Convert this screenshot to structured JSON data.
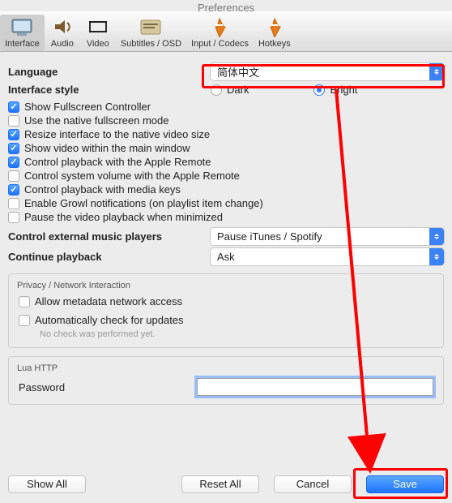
{
  "title": "Preferences",
  "toolbar": {
    "tabs": [
      {
        "label": "Interface",
        "active": true
      },
      {
        "label": "Audio"
      },
      {
        "label": "Video"
      },
      {
        "label": "Subtitles / OSD"
      },
      {
        "label": "Input / Codecs"
      },
      {
        "label": "Hotkeys"
      }
    ]
  },
  "language": {
    "label": "Language",
    "value": "简体中文"
  },
  "interface_style": {
    "label": "Interface style",
    "options": {
      "dark": "Dark",
      "bright": "Bright"
    },
    "selected": "bright"
  },
  "checks": [
    {
      "label": "Show Fullscreen Controller",
      "checked": true
    },
    {
      "label": "Use the native fullscreen mode",
      "checked": false
    },
    {
      "label": "Resize interface to the native video size",
      "checked": true
    },
    {
      "label": "Show video within the main window",
      "checked": true
    },
    {
      "label": "Control playback with the Apple Remote",
      "checked": true
    },
    {
      "label": "Control system volume with the Apple Remote",
      "checked": false
    },
    {
      "label": "Control playback with media keys",
      "checked": true
    },
    {
      "label": "Enable Growl notifications (on playlist item change)",
      "checked": false
    },
    {
      "label": "Pause the video playback when minimized",
      "checked": false
    }
  ],
  "external_players": {
    "label": "Control external music players",
    "value": "Pause iTunes / Spotify"
  },
  "continue_playback": {
    "label": "Continue playback",
    "value": "Ask"
  },
  "privacy": {
    "title": "Privacy / Network Interaction",
    "allow_metadata": {
      "label": "Allow metadata network access",
      "checked": false
    },
    "auto_update": {
      "label": "Automatically check for updates",
      "checked": false
    },
    "no_check": "No check was performed yet."
  },
  "lua": {
    "title": "Lua HTTP",
    "password_label": "Password",
    "password_value": ""
  },
  "buttons": {
    "show_all": "Show All",
    "reset_all": "Reset All",
    "cancel": "Cancel",
    "save": "Save"
  }
}
